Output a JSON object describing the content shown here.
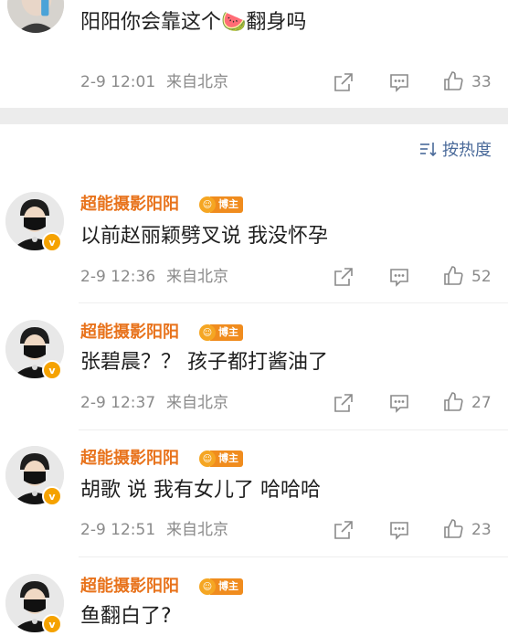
{
  "top_comment": {
    "text": "阳阳你会靠这个🍉翻身吗",
    "time": "2-9 12:01",
    "location": "来自北京",
    "likes": "33"
  },
  "sort": {
    "label": "按热度"
  },
  "comments": [
    {
      "username": "超能摄影阳阳",
      "badge": "博主",
      "text": "以前赵丽颖劈叉说 我没怀孕",
      "time": "2-9 12:36",
      "location": "来自北京",
      "likes": "52"
    },
    {
      "username": "超能摄影阳阳",
      "badge": "博主",
      "text": "张碧晨？？  孩子都打酱油了",
      "time": "2-9 12:37",
      "location": "来自北京",
      "likes": "27"
    },
    {
      "username": "超能摄影阳阳",
      "badge": "博主",
      "text": "胡歌 说 我有女儿了 哈哈哈",
      "time": "2-9 12:51",
      "location": "来自北京",
      "likes": "23"
    },
    {
      "username": "超能摄影阳阳",
      "badge": "博主",
      "text": "鱼翻白了?"
    }
  ],
  "verified_mark": "v",
  "colors": {
    "username": "#e8731c",
    "meta": "#8a8a8a",
    "sort": "#4a6a9a",
    "badge": "#f08c1e"
  }
}
